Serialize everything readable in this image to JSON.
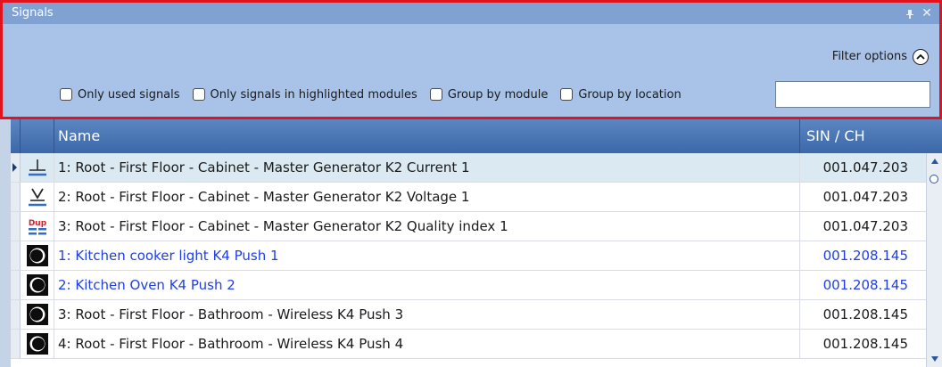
{
  "panel": {
    "title": "Signals",
    "pin_icon": "pin-icon",
    "close_icon": "close-icon",
    "filter_options_label": "Filter options",
    "filter_options_icon": "chevron-up-icon",
    "checkboxes": [
      {
        "label": "Only used signals",
        "checked": false
      },
      {
        "label": "Only signals in highlighted modules",
        "checked": false
      },
      {
        "label": "Group by module",
        "checked": false
      },
      {
        "label": "Group by location",
        "checked": false
      }
    ],
    "search_value": ""
  },
  "grid": {
    "columns": {
      "name": "Name",
      "sin": "SIN / CH"
    },
    "rows": [
      {
        "icon": "current-icon",
        "name": "1: Root - First Floor - Cabinet - Master Generator K2 Current 1",
        "sin": "001.047.203",
        "link": false,
        "selected": true
      },
      {
        "icon": "voltage-icon",
        "name": "2: Root - First Floor - Cabinet - Master Generator K2 Voltage 1",
        "sin": "001.047.203",
        "link": false,
        "selected": false
      },
      {
        "icon": "quality-dup-icon",
        "name": "3: Root - First Floor - Cabinet - Master Generator K2 Quality index 1",
        "sin": "001.047.203",
        "link": false,
        "selected": false
      },
      {
        "icon": "push-button-icon",
        "name": "1: Kitchen cooker light K4 Push 1",
        "sin": "001.208.145",
        "link": true,
        "selected": false
      },
      {
        "icon": "push-button-icon",
        "name": "2: Kitchen Oven K4 Push 2",
        "sin": "001.208.145",
        "link": true,
        "selected": false
      },
      {
        "icon": "push-button-icon",
        "name": "3: Root - First Floor - Bathroom - Wireless K4 Push 3",
        "sin": "001.208.145",
        "link": false,
        "selected": false
      },
      {
        "icon": "push-button-icon",
        "name": "4: Root - First Floor - Bathroom - Wireless K4 Push 4",
        "sin": "001.208.145",
        "link": false,
        "selected": false
      }
    ]
  },
  "colors": {
    "outline": "#e0141e",
    "panel_bg": "#a9c3e8",
    "header_bg": "#4a78b8",
    "selected_row": "#dbe9f2",
    "link_text": "#1f3ee6"
  }
}
